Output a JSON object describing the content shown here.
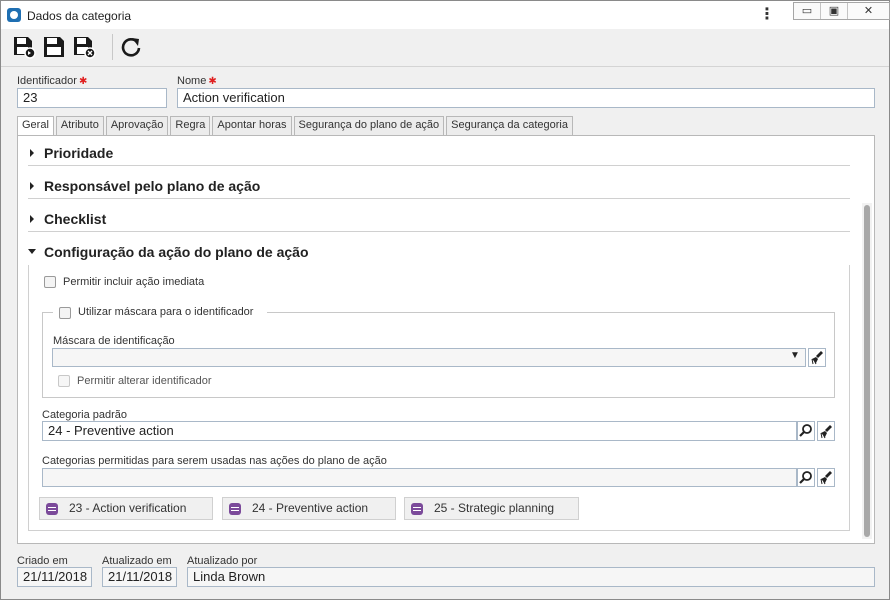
{
  "window": {
    "title": "Dados da categoria",
    "menu_icon": "kebab-menu-icon",
    "controls": {
      "minimize": "▭",
      "restore": "▣",
      "close": "✕"
    }
  },
  "toolbar": {
    "buttons": [
      {
        "name": "save-new-icon"
      },
      {
        "name": "save-icon"
      },
      {
        "name": "save-close-icon"
      },
      {
        "name": "refresh-icon"
      }
    ]
  },
  "form": {
    "id_label": "Identificador",
    "id_value": "23",
    "name_label": "Nome",
    "name_value": "Action verification",
    "required_mark": "✱"
  },
  "tabs": [
    "Geral",
    "Atributo",
    "Aprovação",
    "Regra",
    "Apontar horas",
    "Segurança do plano de ação",
    "Segurança da categoria"
  ],
  "sections": {
    "prioridade": "Prioridade",
    "responsavel": "Responsável pelo plano de ação",
    "checklist": "Checklist",
    "configuracao": "Configuração da ação do plano de ação"
  },
  "config": {
    "permitir_incluir": "Permitir incluir ação imediata",
    "utilizar_mascara": "Utilizar máscara para o identificador",
    "mascara_label": "Máscara de identificação",
    "mascara_value": "",
    "permitir_alterar": "Permitir alterar identificador",
    "categoria_padrao_label": "Categoria padrão",
    "categoria_padrao_value": "24 - Preventive action",
    "categorias_permitidas_label": "Categorias permitidas para serem usadas nas ações do plano de ação",
    "categorias_permitidas_value": "",
    "chips": [
      "23 - Action verification",
      "24 - Preventive action",
      "25 - Strategic planning"
    ]
  },
  "footer": {
    "criado_label": "Criado em",
    "criado_value": "21/11/2018",
    "atualizado_label": "Atualizado em",
    "atualizado_value": "21/11/2018",
    "atualizado_por_label": "Atualizado por",
    "atualizado_por_value": "Linda Brown"
  },
  "colors": {
    "accent": "#1f6fb2",
    "chip_icon": "#7b4a9a",
    "required": "#e02020"
  }
}
